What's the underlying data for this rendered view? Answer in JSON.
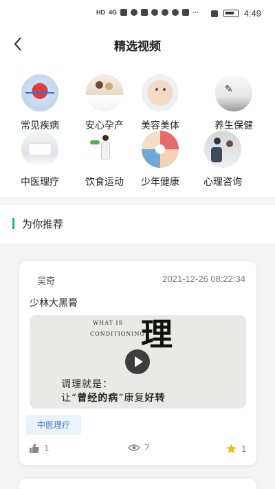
{
  "status": {
    "network": "HD",
    "signal_type": "4G",
    "time": "4:49"
  },
  "header": {
    "title": "精选视频"
  },
  "categories": [
    {
      "label": "常见疾病"
    },
    {
      "label": "安心孕产"
    },
    {
      "label": "美容美体"
    },
    {
      "label": "养生保健"
    },
    {
      "label": "中医理疗"
    },
    {
      "label": "饮食运动"
    },
    {
      "label": "少年健康"
    },
    {
      "label": "心理咨询"
    }
  ],
  "section": {
    "title": "为你推荐"
  },
  "feed": [
    {
      "author": "吴奇",
      "date": "2021-12-26 08:22:34",
      "title": "少林大黑膏",
      "video": {
        "en_line1": "WHAT IS",
        "en_line2": "CONDITIONING",
        "big_char": "理",
        "cn_line1": "调理就是：",
        "cn_line2_a": "让“",
        "cn_line2_b": "曾经的病",
        "cn_line2_c": "”康复",
        "cn_line2_d": "好转"
      },
      "tag": "中医理疗",
      "likes": "1",
      "views": "7",
      "favorites": "1"
    }
  ],
  "colors": {
    "accent": "#22b573",
    "tag_text": "#3d7fd6",
    "tag_bg": "#eaf2fb",
    "star": "#f5b800"
  }
}
